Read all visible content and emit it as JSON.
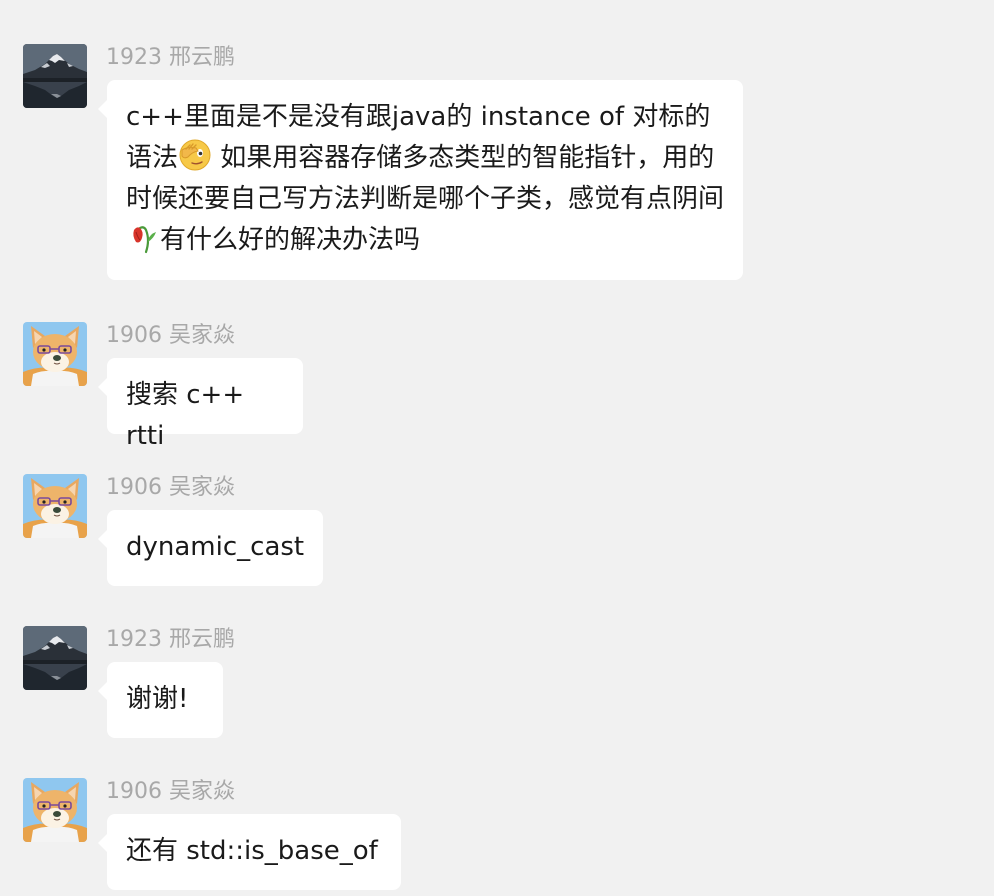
{
  "messages": [
    {
      "sender": "1923 邢云鹏",
      "avatar": "mountain-lake-avatar",
      "text_parts": [
        "c++里面是不是没有跟java的 instance of 对标的语法",
        " 如果用容器存储多态类型的智能指针，用的时候还要自己写方法判断是哪个子类，感觉有点阴间",
        "有什么好的解决办法吗"
      ],
      "emojis": [
        "facepalm-emoji",
        "wilted-flower-emoji"
      ]
    },
    {
      "sender": "1906 吴家焱",
      "avatar": "shiba-dog-avatar",
      "text": "搜索 c++ rtti"
    },
    {
      "sender": "1906 吴家焱",
      "avatar": "shiba-dog-avatar",
      "text": "dynamic_cast"
    },
    {
      "sender": "1923 邢云鹏",
      "avatar": "mountain-lake-avatar",
      "text": "谢谢!"
    },
    {
      "sender": "1906 吴家焱",
      "avatar": "shiba-dog-avatar",
      "text": "还有 std::is_base_of"
    }
  ],
  "colors": {
    "background": "#f1f1f1",
    "bubble": "#ffffff",
    "sender_text": "#a8a8a8",
    "message_text": "#1a1a1a"
  }
}
